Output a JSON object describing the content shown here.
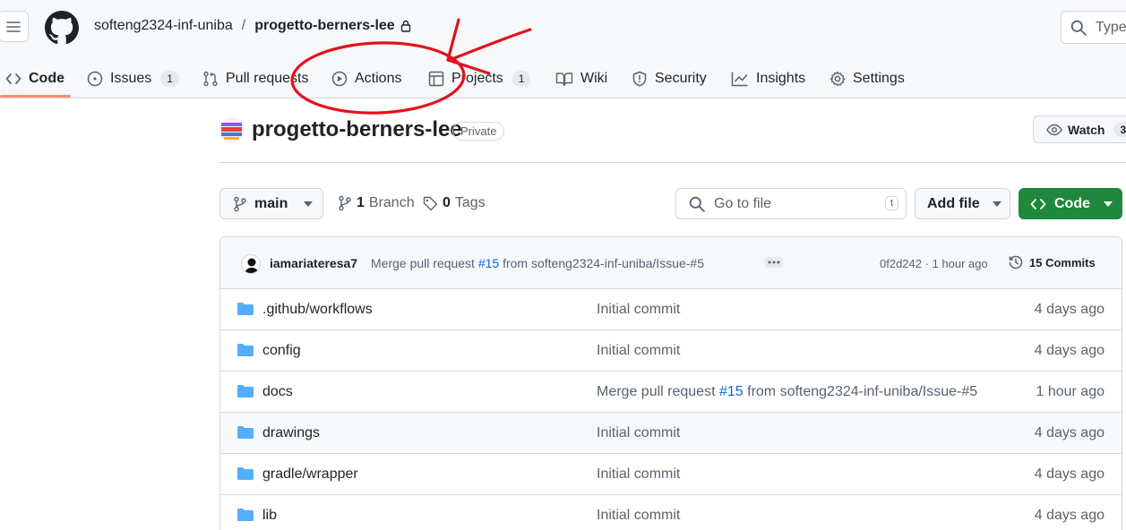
{
  "header": {
    "owner": "softeng2324-inf-uniba",
    "separator": "/",
    "repo": "progetto-berners-lee",
    "search_label": "Type"
  },
  "tabs": [
    {
      "label": "Code",
      "icon": "code-icon"
    },
    {
      "label": "Issues",
      "icon": "issue-icon",
      "count": "1"
    },
    {
      "label": "Pull requests",
      "icon": "pull-request-icon"
    },
    {
      "label": "Actions",
      "icon": "play-icon"
    },
    {
      "label": "Projects",
      "icon": "table-icon",
      "count": "1"
    },
    {
      "label": "Wiki",
      "icon": "book-icon"
    },
    {
      "label": "Security",
      "icon": "shield-icon"
    },
    {
      "label": "Insights",
      "icon": "graph-icon"
    },
    {
      "label": "Settings",
      "icon": "gear-icon"
    }
  ],
  "repo": {
    "name": "progetto-berners-lee",
    "visibility": "Private",
    "watch_label": "Watch",
    "watch_count": "3"
  },
  "toolbar": {
    "branch": "main",
    "branches_count": "1",
    "branches_label": "Branch",
    "tags_count": "0",
    "tags_label": "Tags",
    "goto_placeholder": "Go to file",
    "goto_key": "t",
    "add_file_label": "Add file",
    "code_label": "Code"
  },
  "latest_commit": {
    "author": "iamariateresa7",
    "message_prefix": "Merge pull request",
    "pr": "#15",
    "message_suffix": "from softeng2324-inf-uniba/Issue-#5",
    "hash": "0f2d242",
    "time": "1 hour ago",
    "commits_label": "15 Commits"
  },
  "files": [
    {
      "name": ".github/workflows",
      "message": "Initial commit",
      "date": "4 days ago"
    },
    {
      "name": "config",
      "message": "Initial commit",
      "date": "4 days ago"
    },
    {
      "name": "docs",
      "message_prefix": "Merge pull request",
      "pr": "#15",
      "message_suffix": "from softeng2324-inf-uniba/Issue-#5",
      "date": "1 hour ago"
    },
    {
      "name": "drawings",
      "message": "Initial commit",
      "date": "4 days ago"
    },
    {
      "name": "gradle/wrapper",
      "message": "Initial commit",
      "date": "4 days ago"
    },
    {
      "name": "lib",
      "message": "Initial commit",
      "date": "4 days ago"
    }
  ],
  "colors": {
    "accent_underline": "#fd8c73",
    "primary_button": "#1f883d",
    "folder": "#54aeff",
    "link": "#0969da",
    "annotation": "#e3131b"
  }
}
